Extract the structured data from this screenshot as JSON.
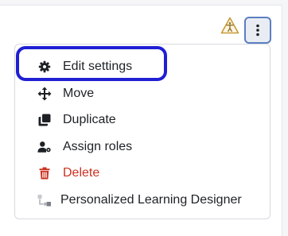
{
  "header": {
    "warning_icon": "accessibility-warning-icon",
    "actions_icon": "vertical-ellipsis-icon"
  },
  "menu": {
    "items": [
      {
        "label": "Edit settings",
        "icon": "gear-icon"
      },
      {
        "label": "Move",
        "icon": "move-arrows-icon"
      },
      {
        "label": "Duplicate",
        "icon": "copy-icon"
      },
      {
        "label": "Assign roles",
        "icon": "user-cog-icon"
      },
      {
        "label": "Delete",
        "icon": "trash-icon",
        "color": "#ca3120"
      },
      {
        "label": "Personalized Learning Designer",
        "icon": "pld-flow-icon"
      }
    ]
  },
  "colors": {
    "focus_ring": "#1f1fd4",
    "kebab_border": "#5b7fc1",
    "danger": "#ca3120",
    "warning": "#c79a3a"
  }
}
